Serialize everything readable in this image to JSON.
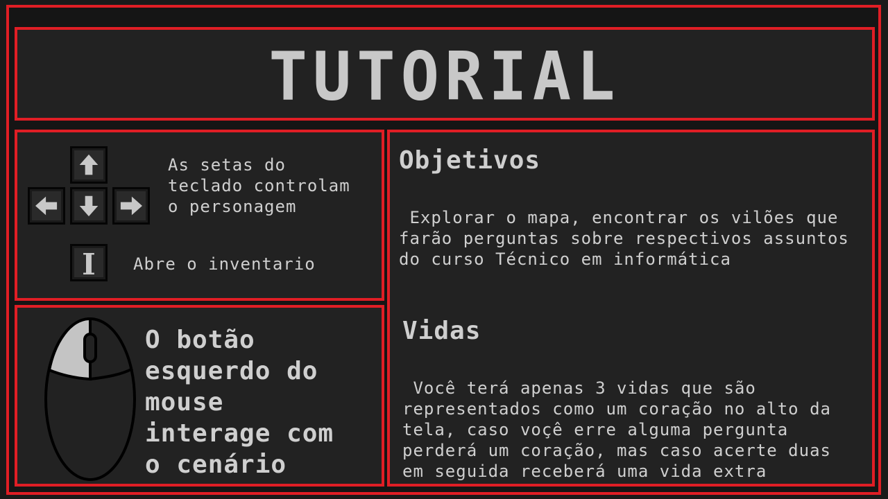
{
  "title": "TUTORIAL",
  "controls": {
    "arrows_text": "As setas do\nteclado controlam\no personagem",
    "inventory_key": "I",
    "inventory_text": "Abre o inventario"
  },
  "mouse": {
    "text": "O botão\nesquerdo do\nmouse\ninterage com\no cenário"
  },
  "objectives": {
    "title": "Objetivos",
    "text": " Explorar o mapa, encontrar os vilões que\nfarão perguntas sobre respectivos assuntos\ndo curso Técnico em informática"
  },
  "lives": {
    "title": "Vidas",
    "text": " Você terá apenas 3 vidas que são\nrepresentados como um coração no alto da\ntela, caso voçê erre alguma pergunta\nperderá um coração, mas caso acerte duas\nem seguida receberá uma vida extra"
  },
  "colors": {
    "border": "#e01e25",
    "panel": "#222222",
    "text": "#cfcfcf",
    "key_icon": "#c8c8c8"
  }
}
